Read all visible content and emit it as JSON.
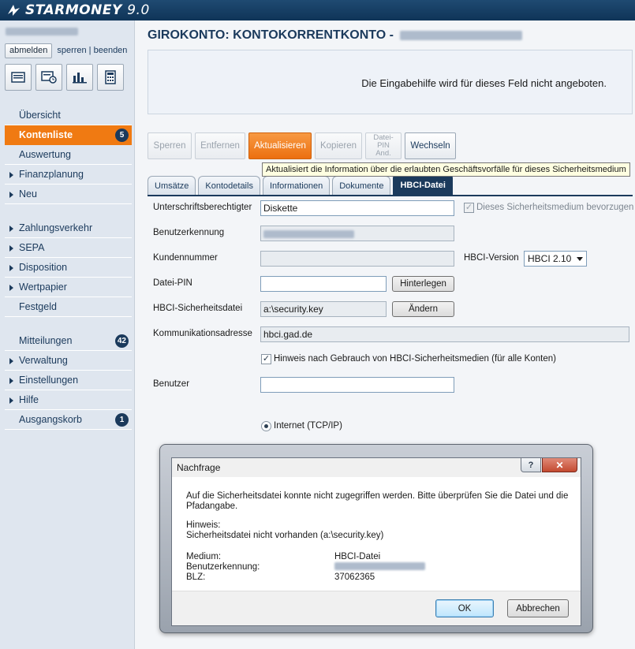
{
  "app": {
    "name_bold": "STARMONEY",
    "name_version": "9.0"
  },
  "session": {
    "logout_label": "abmelden",
    "links": "sperren | beenden"
  },
  "sidebar": {
    "items": [
      {
        "label": "Übersicht"
      },
      {
        "label": "Kontenliste",
        "badge": "5"
      },
      {
        "label": "Auswertung"
      },
      {
        "label": "Finanzplanung"
      },
      {
        "label": "Neu"
      },
      {
        "label": "Zahlungsverkehr"
      },
      {
        "label": "SEPA"
      },
      {
        "label": "Disposition"
      },
      {
        "label": "Wertpapier"
      },
      {
        "label": "Festgeld"
      },
      {
        "label": "Mitteilungen",
        "badge": "42"
      },
      {
        "label": "Verwaltung"
      },
      {
        "label": "Einstellungen"
      },
      {
        "label": "Hilfe"
      },
      {
        "label": "Ausgangskorb",
        "badge": "1"
      }
    ]
  },
  "main": {
    "title": "GIROKONTO: KONTOKORRENTKONTO -",
    "help_text": "Die Eingabehilfe wird für dieses Feld nicht angeboten.",
    "toolbar": {
      "sperren": "Sperren",
      "entfernen": "Entfernen",
      "aktualisieren": "Aktualisieren",
      "kopieren": "Kopieren",
      "datei_pin_1": "Datei-",
      "datei_pin_2": "PIN",
      "datei_pin_3": "And.",
      "wechseln": "Wechseln"
    },
    "tooltip": "Aktualisiert die Information über die erlaubten Geschäftsvorfälle für dieses Sicherheitsmedium",
    "tabs": [
      "Umsätze",
      "Kontodetails",
      "Informationen",
      "Dokumente",
      "HBCI-Datei"
    ],
    "form": {
      "unterschrift_label": "Unterschriftsberechtigter",
      "unterschrift_value": "Diskette",
      "bevorzugen_label": "Dieses Sicherheitsmedium bevorzugen",
      "benutzerkennung_label": "Benutzerkennung",
      "kundennummer_label": "Kundennummer",
      "hbci_version_label": "HBCI-Version",
      "hbci_version_value": "HBCI 2.10",
      "datei_pin_label": "Datei-PIN",
      "hinterlegen_label": "Hinterlegen",
      "sicherheitsdatei_label": "HBCI-Sicherheitsdatei",
      "sicherheitsdatei_value": "a:\\security.key",
      "aendern_label": "Ändern",
      "kommunikation_label": "Kommunikationsadresse",
      "kommunikation_value": "hbci.gad.de",
      "hinweis_label": "Hinweis nach Gebrauch von HBCI-Sicherheitsmedien (für alle Konten)",
      "benutzer_label": "Benutzer",
      "internet_label": "Internet (TCP/IP)"
    }
  },
  "dialog": {
    "title": "Nachfrage",
    "message_1": "Auf die Sicherheitsdatei konnte nicht zugegriffen werden. Bitte überprüfen Sie die Datei und die",
    "message_2": "Pfadangabe.",
    "hint_label": "Hinweis:",
    "hint_text": "Sicherheitsdatei nicht vorhanden (a:\\security.key)",
    "medium_label": "Medium:",
    "medium_value": "HBCI-Datei",
    "kennung_label": "Benutzerkennung:",
    "blz_label": "BLZ:",
    "blz_value": "37062365",
    "ok_label": "OK",
    "cancel_label": "Abbrechen"
  }
}
